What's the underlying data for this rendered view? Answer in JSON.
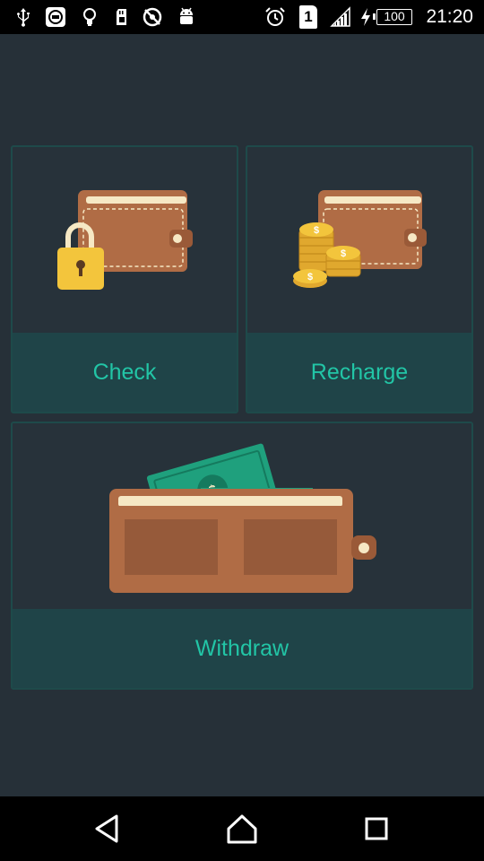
{
  "status_bar": {
    "time": "21:20",
    "battery_level": "100",
    "sim_slot": "1",
    "left_icons": [
      "usb-icon",
      "screenshot-icon",
      "bulb-icon",
      "sd-card-icon",
      "no-location-icon",
      "android-icon"
    ],
    "right_icons": [
      "alarm-icon",
      "sim-icon",
      "signal-icon",
      "charging-icon",
      "battery-icon"
    ]
  },
  "cards": {
    "check": {
      "label": "Check",
      "icon": "wallet-lock-icon"
    },
    "recharge": {
      "label": "Recharge",
      "icon": "wallet-coins-icon"
    },
    "withdraw": {
      "label": "Withdraw",
      "icon": "wallet-cash-icon"
    }
  },
  "nav_bar": {
    "buttons": [
      "back-button",
      "home-button",
      "recents-button"
    ]
  },
  "colors": {
    "background": "#263038",
    "card_border": "#1e4a4a",
    "label_background": "#1f4448",
    "label_text": "#22c5a6",
    "wallet_brown": "#b06c45",
    "lock_yellow": "#f3c53c",
    "cash_green": "#1fa07d",
    "coin_gold": "#f0bf3c"
  }
}
